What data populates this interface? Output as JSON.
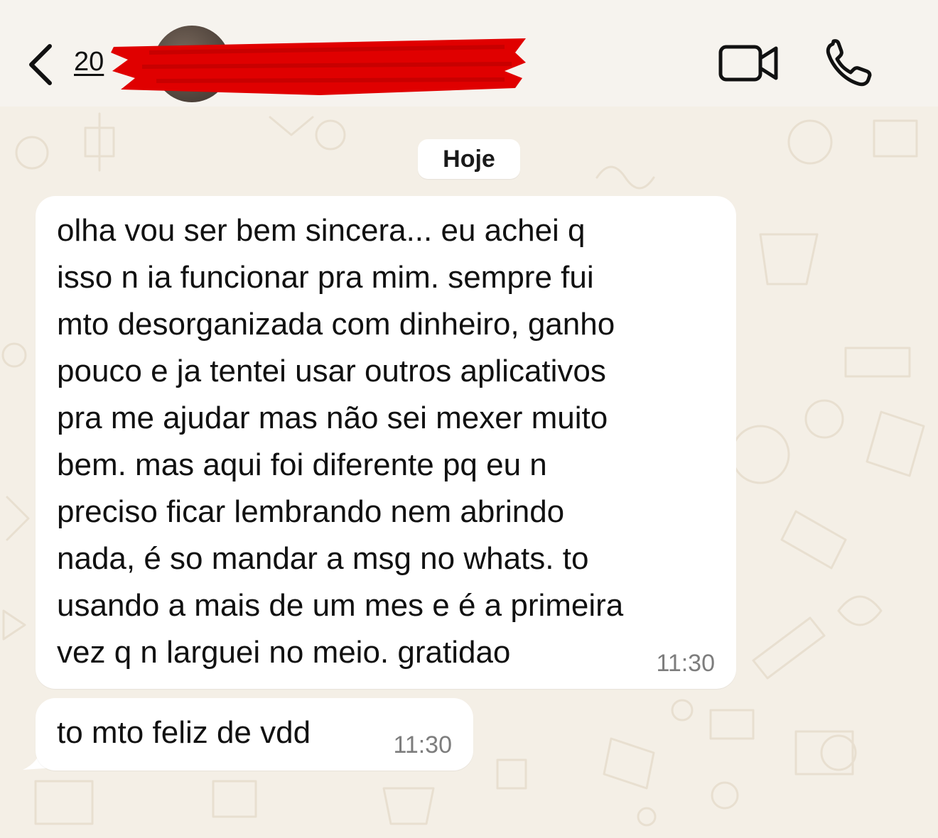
{
  "header": {
    "back_icon": "chevron-left-icon",
    "unread_count": "20",
    "contact_name_redacted": true,
    "video_icon": "video-camera-icon",
    "call_icon": "phone-icon"
  },
  "chat": {
    "date_separator": "Hoje",
    "messages": [
      {
        "text": "olha vou ser bem sincera... eu achei q\nisso n ia funcionar pra mim. sempre fui\nmto desorganizada com dinheiro, ganho\npouco e ja tentei usar outros aplicativos\npra me ajudar mas não sei mexer muito\nbem. mas aqui foi diferente pq eu n\npreciso ficar lembrando nem abrindo\nnada, é so mandar a msg no whats. to\nusando a mais de um mes e é a primeira\nvez q n larguei no meio. gratidao",
        "time": "11:30"
      },
      {
        "text": "to mto feliz de vdd",
        "time": "11:30"
      }
    ]
  },
  "colors": {
    "background": "#f4efe6",
    "header": "#f6f3ee",
    "bubble": "#ffffff",
    "redaction": "#e00000",
    "timestamp": "#7d7d7d"
  }
}
